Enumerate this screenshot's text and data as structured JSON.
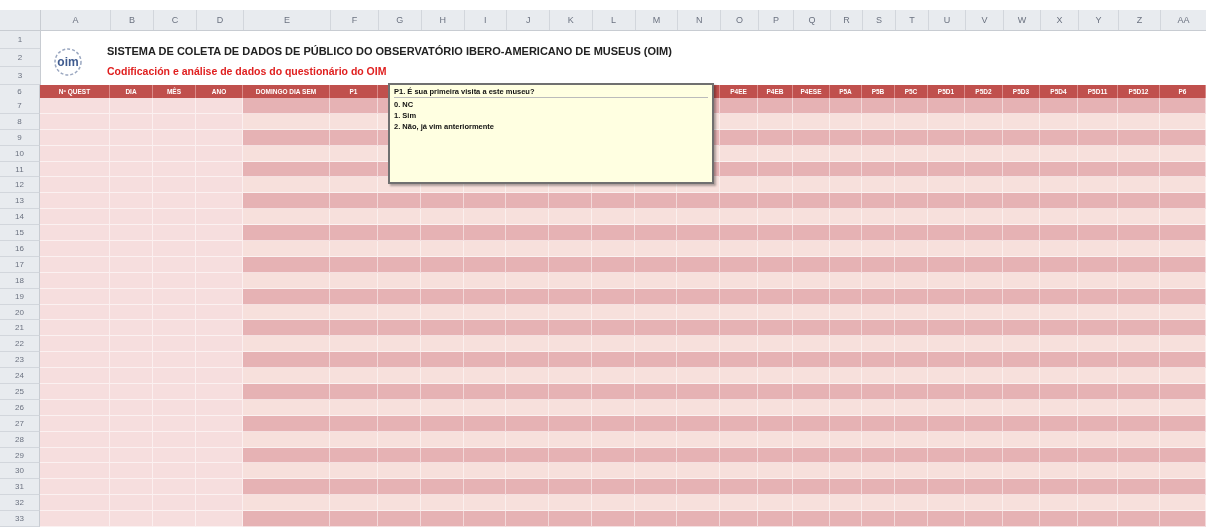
{
  "column_letters": [
    "A",
    "B",
    "C",
    "D",
    "E",
    "F",
    "G",
    "H",
    "I",
    "J",
    "K",
    "L",
    "M",
    "N",
    "O",
    "P",
    "Q",
    "R",
    "S",
    "T",
    "U",
    "V",
    "W",
    "X",
    "Y",
    "Z",
    "AA"
  ],
  "top_rows": [
    "1",
    "2",
    "3"
  ],
  "logo": {
    "text": "oim"
  },
  "title": "SISTEMA DE COLETA DE DADOS DE PÚBLICO DO OBSERVATÓRIO IBERO-AMERICANO DE MUSEUS (OIM)",
  "subtitle": "Codificación e análise de dados do questionário do OIM",
  "header_row": {
    "row": "6",
    "left": [
      "Nº QUEST",
      "DIA",
      "MÊS",
      "ANO",
      "DOMINGO DIA SEM",
      "P1"
    ],
    "right": [
      "P4EE",
      "P4EB",
      "P4ESE",
      "P5A",
      "P5B",
      "P5C",
      "P5D1",
      "P5D2",
      "P5D3",
      "P5D4",
      "P5D11",
      "P5D12",
      "P6"
    ]
  },
  "body_rows": [
    "7",
    "8",
    "9",
    "10",
    "11",
    "12",
    "13",
    "14",
    "15",
    "16",
    "17",
    "18",
    "19",
    "20",
    "21",
    "22",
    "23",
    "24",
    "25",
    "26",
    "27",
    "28",
    "29",
    "30",
    "31",
    "32",
    "33"
  ],
  "comment": {
    "title": "P1. É sua primeira visita a este museu?",
    "lines": [
      "0. NC",
      "1. Sim",
      "2. Não, já vim anteriormente"
    ]
  }
}
